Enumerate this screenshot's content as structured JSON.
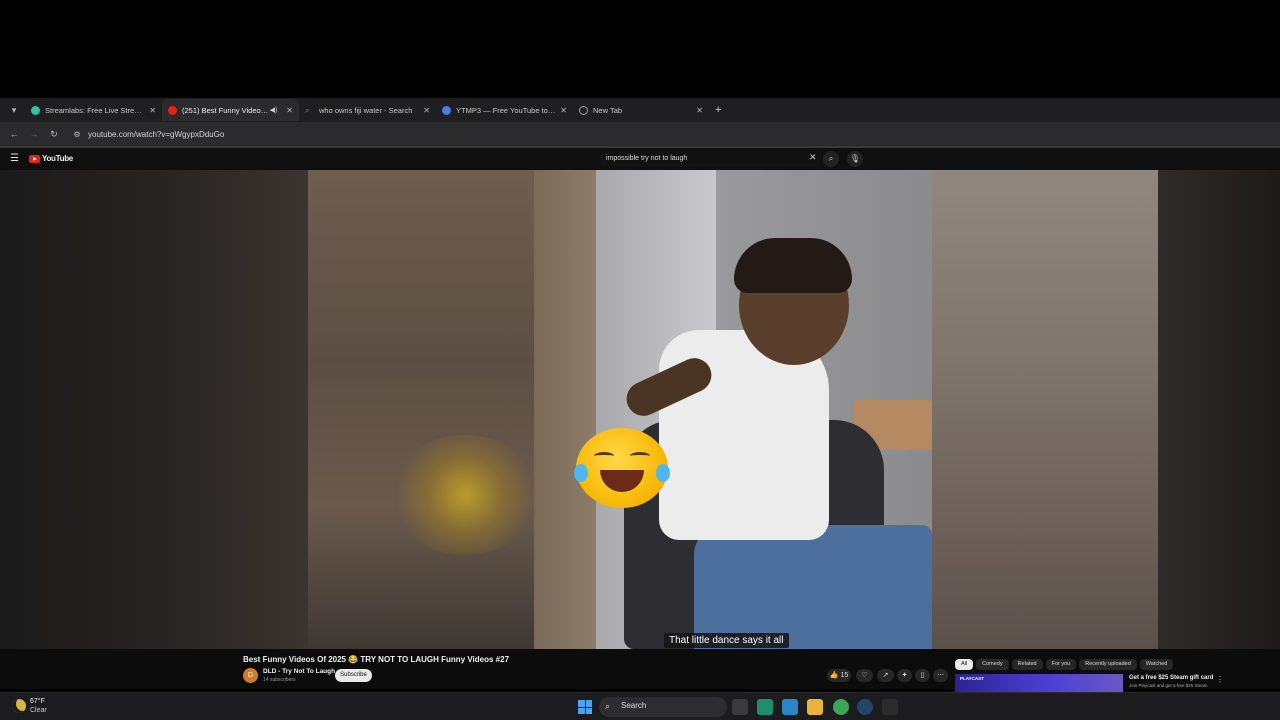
{
  "browser": {
    "tabs": [
      {
        "title": "Streamlabs: Free Live Streaming",
        "favicon_color": "#31c3a2",
        "active": false,
        "audio": false
      },
      {
        "title": "(251) Best Funny Videos Of",
        "favicon_color": "#e62117",
        "active": true,
        "audio": true
      },
      {
        "title": "who owns fiji water - Search",
        "favicon_color": "#3c8cf0",
        "active": false,
        "audio": false
      },
      {
        "title": "YTMP3 — Free YouTube to MP3",
        "favicon_color": "#4a7ee0",
        "active": false,
        "audio": false
      },
      {
        "title": "New Tab",
        "favicon_color": "#9aa0a6",
        "active": false,
        "audio": false
      }
    ],
    "address": {
      "url": "youtube.com/watch?v=gWgypxDduGo"
    }
  },
  "youtube": {
    "logo_text": "YouTube",
    "search_query": "impossible try not to laugh",
    "video": {
      "caption": "That little dance says it all",
      "title": "Best Funny Videos Of 2025 😂 TRY NOT TO LAUGH Funny Videos #27",
      "channel": {
        "avatar_letter": "D",
        "name": "DLD - Try Not To Laugh",
        "subscribers": "14 subscribers"
      },
      "subscribe_label": "Subscribe",
      "like_count": "15"
    },
    "chips": [
      "All",
      "Comedy",
      "Related",
      "For you",
      "Recently uploaded",
      "Watched"
    ],
    "ad": {
      "thumb_label": "PLAYCAST",
      "title": "Get a free $25 Steam gift card",
      "description": "Join Playcast and get a free $25 Steam"
    }
  },
  "taskbar": {
    "weather": {
      "temp": "67°F",
      "condition": "Clear"
    },
    "search_label": "Search",
    "apps": [
      {
        "name": "task-view",
        "color": "#3a3a3a"
      },
      {
        "name": "green-app",
        "color": "#1f8f6a"
      },
      {
        "name": "edge",
        "color": "#2a86c9"
      },
      {
        "name": "file-explorer",
        "color": "#e8b53a"
      },
      {
        "name": "chrome",
        "color": "#3aa757"
      },
      {
        "name": "steam",
        "color": "#24466e"
      },
      {
        "name": "obs",
        "color": "#2c2c2c"
      }
    ]
  }
}
